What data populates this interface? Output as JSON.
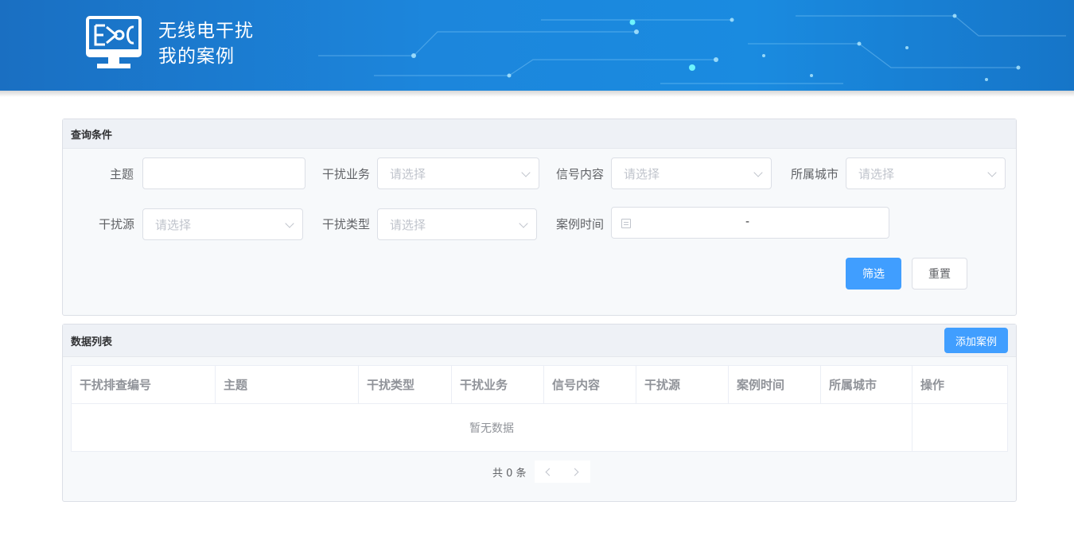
{
  "header": {
    "title_line1": "无线电干扰",
    "title_line2": "我的案例"
  },
  "query_panel": {
    "title": "查询条件",
    "fields": {
      "subject": {
        "label": "主题",
        "value": ""
      },
      "business": {
        "label": "干扰业务",
        "placeholder": "请选择"
      },
      "signal": {
        "label": "信号内容",
        "placeholder": "请选择"
      },
      "city": {
        "label": "所属城市",
        "placeholder": "请选择"
      },
      "source": {
        "label": "干扰源",
        "placeholder": "请选择"
      },
      "type": {
        "label": "干扰类型",
        "placeholder": "请选择"
      },
      "time": {
        "label": "案例时间",
        "separator": "-"
      }
    },
    "filter_label": "筛选",
    "reset_label": "重置"
  },
  "list_panel": {
    "title": "数据列表",
    "add_label": "添加案例",
    "columns": [
      "干扰排查编号",
      "主题",
      "干扰类型",
      "干扰业务",
      "信号内容",
      "干扰源",
      "案例时间",
      "所属城市",
      "操作"
    ],
    "empty_text": "暂无数据",
    "pager_total": "共 0 条"
  },
  "colors": {
    "primary": "#409eff",
    "header_blue": "#1c86dc"
  }
}
